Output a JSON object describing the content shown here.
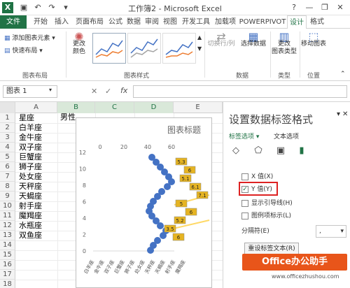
{
  "window": {
    "title": "工作簿2 - Microsoft Excel"
  },
  "tabs": [
    "文件",
    "开始",
    "插入",
    "页面布局",
    "公式",
    "数据",
    "审阅",
    "视图",
    "开发工具",
    "加载项",
    "POWERPIVOT",
    "设计",
    "格式"
  ],
  "ribbon": {
    "add_element": "添加图表元素",
    "quick_layout": "快速布局",
    "change_colors": "更改\n颜色",
    "switch_rowcol": "切换行/列",
    "select_data": "选择数据",
    "change_type": "更改\n图表类型",
    "move_chart": "移动图表",
    "groups": {
      "layout": "图表布局",
      "styles": "图表样式",
      "data": "数据",
      "type": "类型",
      "location": "位置"
    }
  },
  "formula_bar": {
    "name_box": "图表 1",
    "fx": "fx"
  },
  "sheet": {
    "columns": [
      "A",
      "B",
      "C",
      "D",
      "E"
    ],
    "rows": [
      "1",
      "2",
      "3",
      "4",
      "5",
      "6",
      "7",
      "8",
      "9",
      "10",
      "11",
      "12",
      "13",
      "14",
      "15",
      "16",
      "17",
      "18"
    ],
    "col_a": [
      "星座",
      "白羊座",
      "金牛座",
      "双子座",
      "巨蟹座",
      "狮子座",
      "处女座",
      "天秤座",
      "天蝎座",
      "射手座",
      "魔羯座",
      "水瓶座",
      "双鱼座"
    ],
    "b1": "男性"
  },
  "chart": {
    "title": "图表标题",
    "x_ticks": [
      "0",
      "20",
      "40",
      "60"
    ],
    "y_ticks": [
      "0",
      "2",
      "4",
      "6",
      "8",
      "10",
      "12"
    ],
    "categories": [
      "白羊座",
      "金牛座",
      "双子座",
      "巨蟹座",
      "狮子座",
      "处女座",
      "天秤座",
      "天蝎座",
      "射手座",
      "魔羯座"
    ],
    "data_labels": [
      "5.3",
      "6",
      "5.1",
      "6.1",
      "7.1",
      "5",
      "6",
      "5.2",
      "3.5",
      "6"
    ],
    "colors": {
      "series_dots": "#4472c4",
      "labels": "#e6b422",
      "line": "#ffd966"
    }
  },
  "pane": {
    "title": "设置数据标签格式",
    "tab_label_options": "标签选项",
    "tab_text_options": "文本选项",
    "options": [
      {
        "label": "X 值(X)",
        "checked": false
      },
      {
        "label": "Y 值(Y)",
        "checked": true
      },
      {
        "label": "显示引导线(H)",
        "checked": false
      },
      {
        "label": "图例项标示(L)",
        "checked": false
      }
    ],
    "separator_label": "分隔符(E)",
    "separator_value": ",",
    "reset_button": "重设标签文本(R)",
    "accent": "#d22222"
  },
  "watermark": {
    "brand": "Office办公助手",
    "url": "www.officezhushou.com"
  }
}
